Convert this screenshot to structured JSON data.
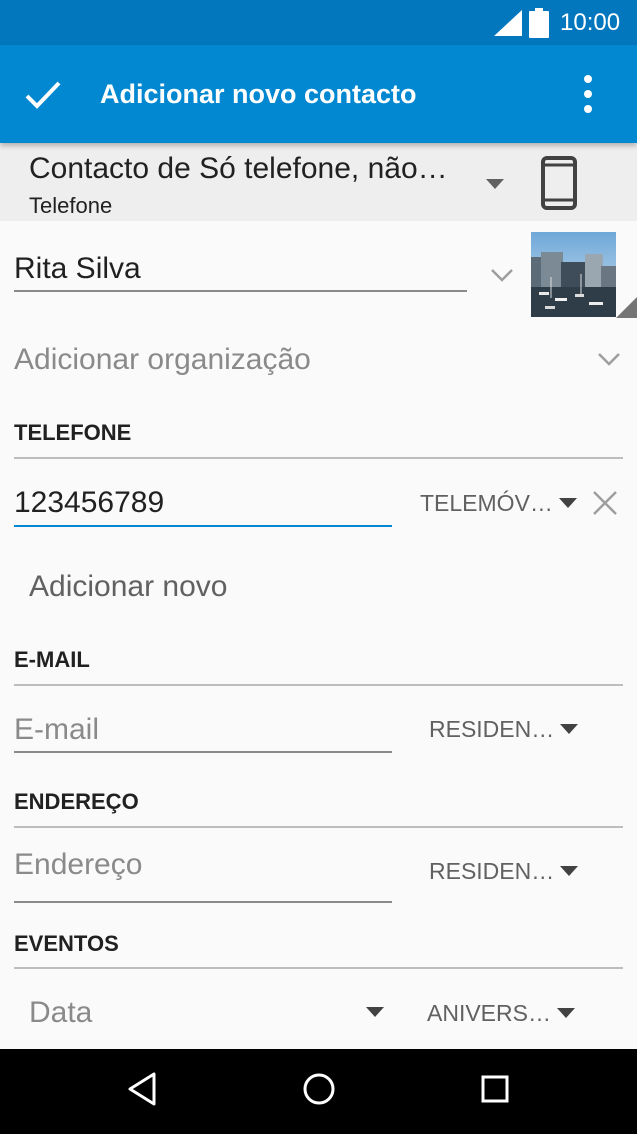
{
  "status": {
    "time": "10:00"
  },
  "appbar": {
    "title": "Adicionar novo contacto"
  },
  "account": {
    "name": "Contacto de Só telefone, não…",
    "type": "Telefone"
  },
  "name_field": {
    "value": "Rita Silva"
  },
  "organization": {
    "placeholder": "Adicionar organização"
  },
  "phone_section": {
    "header": "TELEFONE",
    "number": "123456789",
    "type": "TELEMÓV…",
    "add_new": "Adicionar novo"
  },
  "email_section": {
    "header": "E-MAIL",
    "placeholder": "E-mail",
    "type": "RESIDEN…"
  },
  "address_section": {
    "header": "ENDEREÇO",
    "placeholder": "Endereço",
    "type": "RESIDEN…"
  },
  "events_section": {
    "header": "EVENTOS",
    "date_placeholder": "Data",
    "type": "ANIVERS…"
  },
  "colors": {
    "statusbar": "#0277bd",
    "appbar": "#0288d1",
    "accent": "#0288d1"
  }
}
